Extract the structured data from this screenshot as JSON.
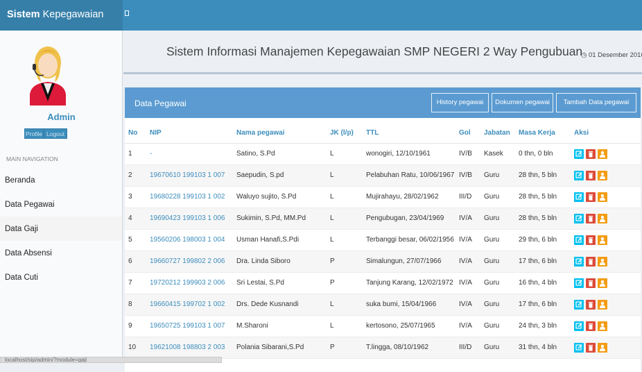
{
  "header": {
    "brand_bold": "Sistem",
    "brand_rest": "Kepegawaian"
  },
  "sidebar": {
    "user_name": "Admin",
    "profile_label": "Profile",
    "logout_label": "Logout",
    "nav_header": "MAIN NAVIGATION",
    "items": [
      {
        "label": "Beranda"
      },
      {
        "label": "Data Pegawai"
      },
      {
        "label": "Data Gaji"
      },
      {
        "label": "Data Absensi"
      },
      {
        "label": "Data Cuti"
      }
    ],
    "active_item": "Data Gaji"
  },
  "main": {
    "title": "Sistem Informasi Manajemen Kepegawaian SMP NEGERI 2 Way Pengubuan",
    "date": "01 Desember 2016",
    "panel_title": "Data Pegawai",
    "buttons": {
      "history": "History pegawai",
      "dokumen": "Dokumen pegawai",
      "tambah": "Tambah Data pegawai"
    },
    "columns": [
      "No",
      "NIP",
      "Nama pegawai",
      "JK (l/p)",
      "TTL",
      "Gol",
      "Jabatan",
      "Masa Kerja",
      "Aksi"
    ],
    "rows": [
      {
        "no": "1",
        "nip": "-",
        "nama": "Satino, S.Pd",
        "jk": "L",
        "ttl": "wonogiri, 12/10/1961",
        "gol": "IV/B",
        "jabatan": "Kasek",
        "masa": "0 thn, 0 bln"
      },
      {
        "no": "2",
        "nip": "19670610 199103 1 007",
        "nama": "Saepudin, S.pd",
        "jk": "L",
        "ttl": "Pelabuhan Ratu, 10/06/1967",
        "gol": "IV/B",
        "jabatan": "Guru",
        "masa": "28 thn, 5 bln"
      },
      {
        "no": "3",
        "nip": "19680228 199103 1 002",
        "nama": "Waluyo sujito, S.Pd",
        "jk": "L",
        "ttl": "Mujirahayu, 28/02/1962",
        "gol": "III/D",
        "jabatan": "Guru",
        "masa": "28 thn, 5 bln"
      },
      {
        "no": "4",
        "nip": "19690423 199103 1 006",
        "nama": "Sukimin, S.Pd, MM.Pd",
        "jk": "L",
        "ttl": "Pengubugan, 23/04/1969",
        "gol": "IV/A",
        "jabatan": "Guru",
        "masa": "28 thn, 5 bln"
      },
      {
        "no": "5",
        "nip": "19560206 198003 1 004",
        "nama": "Usman Hanafi,S.Pdi",
        "jk": "L",
        "ttl": "Terbanggi besar, 06/02/1956",
        "gol": "IV/A",
        "jabatan": "Guru",
        "masa": "29 thn, 6 bln"
      },
      {
        "no": "6",
        "nip": "19660727 199802 2 006",
        "nama": "Dra. Linda Siboro",
        "jk": "P",
        "ttl": "Simalungun, 27/07/1966",
        "gol": "IV/A",
        "jabatan": "Guru",
        "masa": "17 thn, 6 bln"
      },
      {
        "no": "7",
        "nip": "19720212 199903 2 006",
        "nama": "Sri Lestai, S.Pd",
        "jk": "P",
        "ttl": "Tanjung Karang, 12/02/1972",
        "gol": "IV/A",
        "jabatan": "Guru",
        "masa": "16 thn, 4 bln"
      },
      {
        "no": "8",
        "nip": "19660415 199702 1 002",
        "nama": "Drs. Dede Kusnandi",
        "jk": "L",
        "ttl": "suka bumi, 15/04/1966",
        "gol": "IV/A",
        "jabatan": "Guru",
        "masa": "17 thn, 6 bln"
      },
      {
        "no": "9",
        "nip": "19650725 199103 1 007",
        "nama": "M.Sharoni",
        "jk": "L",
        "ttl": "kertosono, 25/07/1965",
        "gol": "IV/A",
        "jabatan": "Guru",
        "masa": "24 thn, 3 bln"
      },
      {
        "no": "10",
        "nip": "19621008 198803 2 003",
        "nama": "Polania Sibarani,S.Pd",
        "jk": "P",
        "ttl": "T.lingga, 08/10/1962",
        "gol": "III/D",
        "jabatan": "Guru",
        "masa": "31 thn, 4 bln"
      }
    ]
  },
  "status_bar": {
    "url": "localhost/sip/admin/?module=gaji"
  },
  "icons": {
    "action_edit": "edit-icon",
    "action_delete": "trash-icon",
    "action_user": "user-icon",
    "date": "clock-icon"
  },
  "colors": {
    "primary": "#3c8dbc",
    "panel_header": "#5b9bd1",
    "edit": "#00c0ef",
    "delete": "#dd4b39",
    "user": "#f39c12"
  }
}
